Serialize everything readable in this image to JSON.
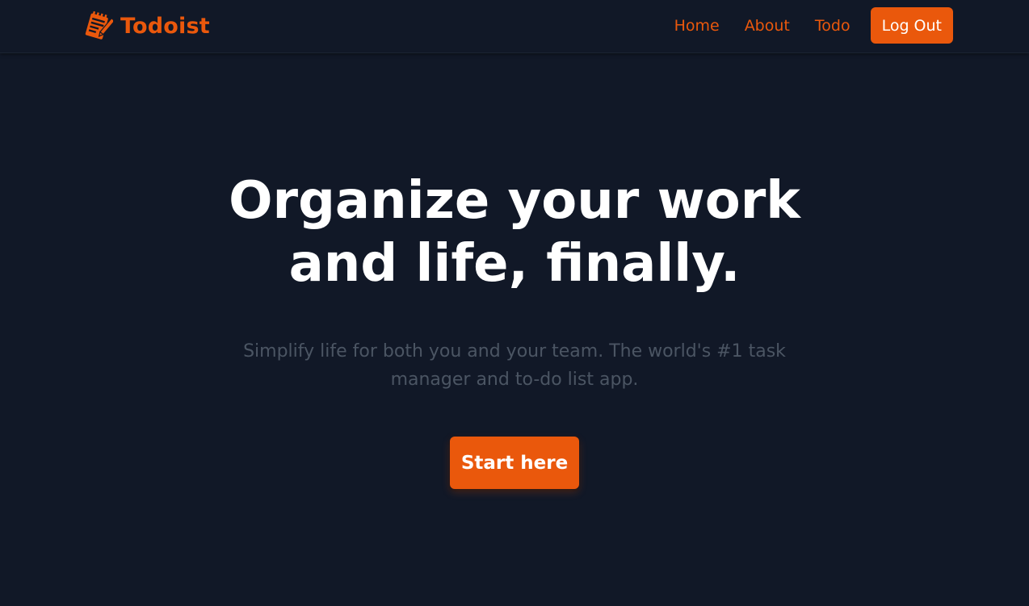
{
  "brand": {
    "name": "Todoist",
    "icon": "notepad-pencil-icon",
    "color": "#ea580c"
  },
  "nav": {
    "links": [
      {
        "label": "Home"
      },
      {
        "label": "About"
      },
      {
        "label": "Todo"
      }
    ],
    "logout_label": "Log Out"
  },
  "hero": {
    "title": "Organize your work and life, finally.",
    "subtitle": "Simplify life for both you and your team. The world's #1 task manager and to-do list app.",
    "cta_label": "Start here"
  },
  "colors": {
    "background": "#111827",
    "accent": "#ea580c",
    "title": "#ffffff",
    "subtitle": "#4b5563"
  }
}
